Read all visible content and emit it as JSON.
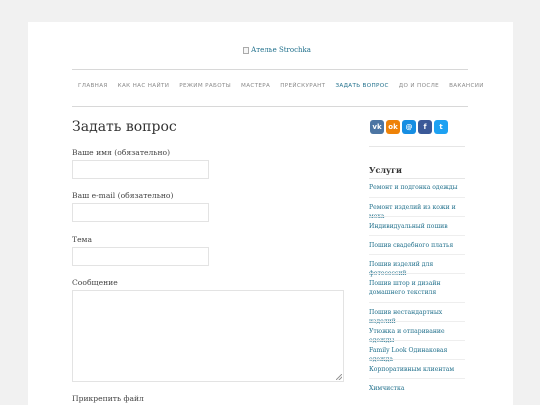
{
  "logo": {
    "alt": "Ателье Strochka"
  },
  "nav": {
    "items": [
      {
        "label": "ГЛАВНАЯ"
      },
      {
        "label": "КАК НАС НАЙТИ"
      },
      {
        "label": "РЕЖИМ РАБОТЫ"
      },
      {
        "label": "МАСТЕРА"
      },
      {
        "label": "ПРЕЙСКУРАНТ"
      },
      {
        "label": "ЗАДАТЬ ВОПРОС"
      },
      {
        "label": "ДО И ПОСЛЕ"
      },
      {
        "label": "ВАКАНСИИ"
      }
    ],
    "active_index": 5
  },
  "form": {
    "title": "Задать вопрос",
    "name_label": "Ваше имя (обязательно)",
    "email_label": "Ваш e-mail (обязательно)",
    "subject_label": "Тема",
    "message_label": "Сообщение",
    "attach_label": "Прикрепить файл"
  },
  "share": [
    {
      "icon": "vk-icon",
      "glyph": "vk",
      "color": "#4c75a3"
    },
    {
      "icon": "odnoklassniki-icon",
      "glyph": "ok",
      "color": "#ee8208"
    },
    {
      "icon": "mailru-icon",
      "glyph": "@",
      "color": "#168de2"
    },
    {
      "icon": "facebook-icon",
      "glyph": "f",
      "color": "#3b5998"
    },
    {
      "icon": "twitter-icon",
      "glyph": "t",
      "color": "#1da1f2"
    }
  ],
  "sidebar": {
    "title": "Услуги",
    "items": [
      "Ремонт и подгонка одежды",
      "Ремонт изделий из кожи и меха",
      "Индивидуальный пошив",
      "Пошив свадебного платья",
      "Пошив изделий для фотосессий",
      "Пошив штор и дизайн домашнего текстиля",
      "Пошив нестандартных изделий",
      "Утюжка и отпаривание одежды",
      "Family Look Одинаковая одежда",
      "Корпоративным клиентам",
      "Химчистка"
    ]
  },
  "colors": {
    "link": "#1f6f8b",
    "background": "#f1f1f1"
  }
}
